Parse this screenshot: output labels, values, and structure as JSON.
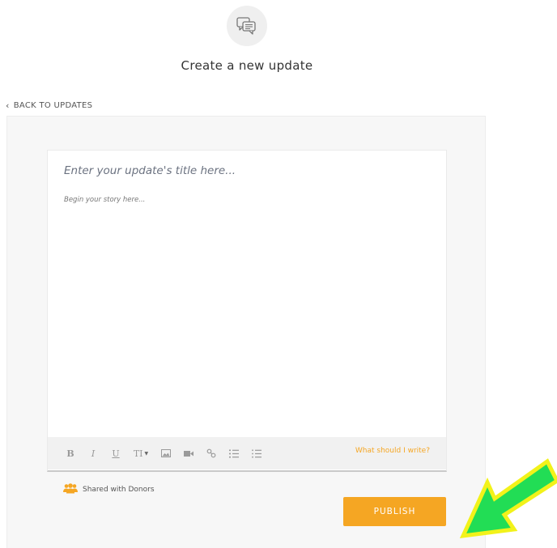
{
  "header": {
    "icon": "chat-bubbles-icon",
    "title": "Create a new update"
  },
  "nav": {
    "back_label": "BACK TO UPDATES",
    "back_icon": "chevron-left-icon"
  },
  "editor": {
    "title_placeholder": "Enter your update's title here...",
    "story_placeholder": "Begin your story here...",
    "toolbar": {
      "bold": "B",
      "italic": "I",
      "underline": "U",
      "text_size": "TI",
      "icons": [
        "image-icon",
        "video-icon",
        "link-icon",
        "ordered-list-icon",
        "unordered-list-icon"
      ],
      "help_link": "What should I write?"
    }
  },
  "footer": {
    "shared_icon": "users-icon",
    "shared_label": "Shared with Donors",
    "publish_label": "PUBLISH"
  },
  "colors": {
    "accent": "#f5a623",
    "arrow_fill": "#22dd55",
    "arrow_outline": "#f2f21a"
  }
}
